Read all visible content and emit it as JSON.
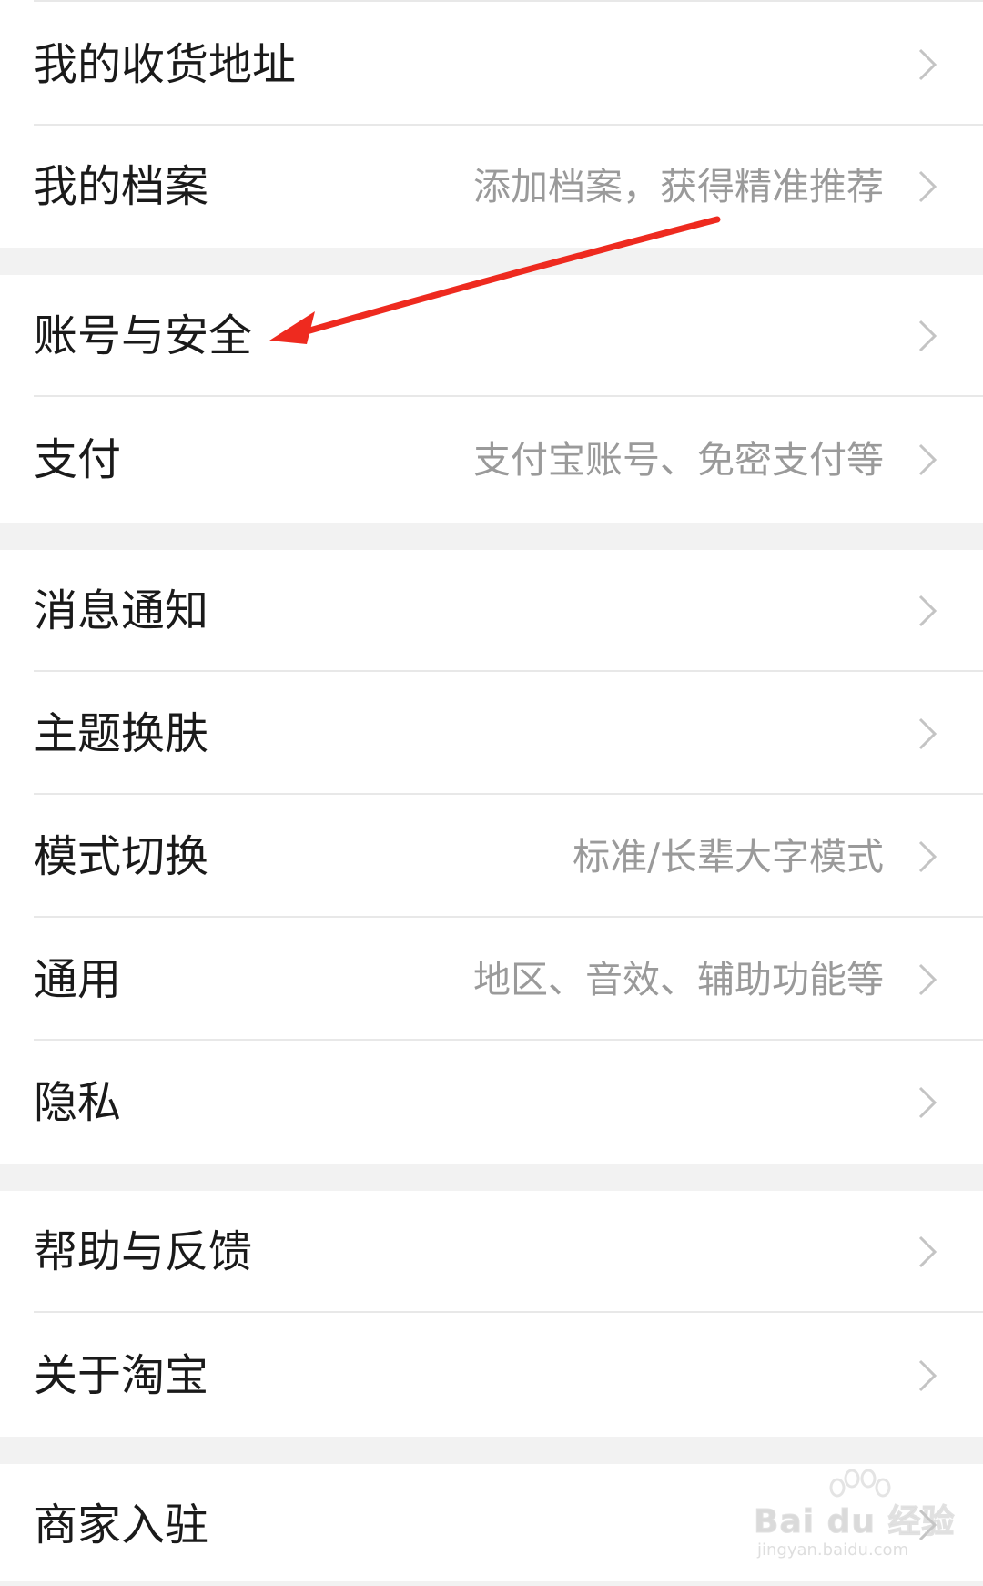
{
  "groups": [
    {
      "items": [
        {
          "label": "我的收货地址",
          "hint": ""
        },
        {
          "label": "我的档案",
          "hint": "添加档案，获得精准推荐"
        }
      ]
    },
    {
      "items": [
        {
          "label": "账号与安全",
          "hint": ""
        },
        {
          "label": "支付",
          "hint": "支付宝账号、免密支付等"
        }
      ]
    },
    {
      "items": [
        {
          "label": "消息通知",
          "hint": ""
        },
        {
          "label": "主题换肤",
          "hint": ""
        },
        {
          "label": "模式切换",
          "hint": "标准/长辈大字模式"
        },
        {
          "label": "通用",
          "hint": "地区、音效、辅助功能等"
        },
        {
          "label": "隐私",
          "hint": ""
        }
      ]
    },
    {
      "items": [
        {
          "label": "帮助与反馈",
          "hint": ""
        },
        {
          "label": "关于淘宝",
          "hint": ""
        }
      ]
    },
    {
      "items": [
        {
          "label": "商家入驻",
          "hint": ""
        }
      ]
    }
  ],
  "annotation": {
    "arrow_color": "#ee2a1f",
    "points_to": "账号与安全"
  },
  "watermark": {
    "brand": "Bai du 经验",
    "url": "jingyan.baidu.com"
  },
  "icons": {
    "row_chevron": "chevron-right-icon"
  }
}
